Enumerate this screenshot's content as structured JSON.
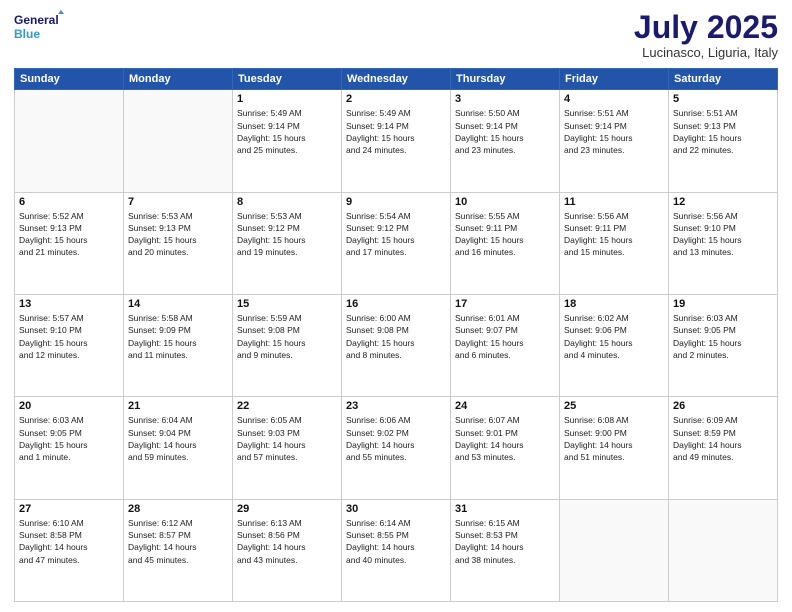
{
  "header": {
    "logo_line1": "General",
    "logo_line2": "Blue",
    "month_title": "July 2025",
    "subtitle": "Lucinasco, Liguria, Italy"
  },
  "weekdays": [
    "Sunday",
    "Monday",
    "Tuesday",
    "Wednesday",
    "Thursday",
    "Friday",
    "Saturday"
  ],
  "weeks": [
    [
      {
        "day": "",
        "info": ""
      },
      {
        "day": "",
        "info": ""
      },
      {
        "day": "1",
        "info": "Sunrise: 5:49 AM\nSunset: 9:14 PM\nDaylight: 15 hours\nand 25 minutes."
      },
      {
        "day": "2",
        "info": "Sunrise: 5:49 AM\nSunset: 9:14 PM\nDaylight: 15 hours\nand 24 minutes."
      },
      {
        "day": "3",
        "info": "Sunrise: 5:50 AM\nSunset: 9:14 PM\nDaylight: 15 hours\nand 23 minutes."
      },
      {
        "day": "4",
        "info": "Sunrise: 5:51 AM\nSunset: 9:14 PM\nDaylight: 15 hours\nand 23 minutes."
      },
      {
        "day": "5",
        "info": "Sunrise: 5:51 AM\nSunset: 9:13 PM\nDaylight: 15 hours\nand 22 minutes."
      }
    ],
    [
      {
        "day": "6",
        "info": "Sunrise: 5:52 AM\nSunset: 9:13 PM\nDaylight: 15 hours\nand 21 minutes."
      },
      {
        "day": "7",
        "info": "Sunrise: 5:53 AM\nSunset: 9:13 PM\nDaylight: 15 hours\nand 20 minutes."
      },
      {
        "day": "8",
        "info": "Sunrise: 5:53 AM\nSunset: 9:12 PM\nDaylight: 15 hours\nand 19 minutes."
      },
      {
        "day": "9",
        "info": "Sunrise: 5:54 AM\nSunset: 9:12 PM\nDaylight: 15 hours\nand 17 minutes."
      },
      {
        "day": "10",
        "info": "Sunrise: 5:55 AM\nSunset: 9:11 PM\nDaylight: 15 hours\nand 16 minutes."
      },
      {
        "day": "11",
        "info": "Sunrise: 5:56 AM\nSunset: 9:11 PM\nDaylight: 15 hours\nand 15 minutes."
      },
      {
        "day": "12",
        "info": "Sunrise: 5:56 AM\nSunset: 9:10 PM\nDaylight: 15 hours\nand 13 minutes."
      }
    ],
    [
      {
        "day": "13",
        "info": "Sunrise: 5:57 AM\nSunset: 9:10 PM\nDaylight: 15 hours\nand 12 minutes."
      },
      {
        "day": "14",
        "info": "Sunrise: 5:58 AM\nSunset: 9:09 PM\nDaylight: 15 hours\nand 11 minutes."
      },
      {
        "day": "15",
        "info": "Sunrise: 5:59 AM\nSunset: 9:08 PM\nDaylight: 15 hours\nand 9 minutes."
      },
      {
        "day": "16",
        "info": "Sunrise: 6:00 AM\nSunset: 9:08 PM\nDaylight: 15 hours\nand 8 minutes."
      },
      {
        "day": "17",
        "info": "Sunrise: 6:01 AM\nSunset: 9:07 PM\nDaylight: 15 hours\nand 6 minutes."
      },
      {
        "day": "18",
        "info": "Sunrise: 6:02 AM\nSunset: 9:06 PM\nDaylight: 15 hours\nand 4 minutes."
      },
      {
        "day": "19",
        "info": "Sunrise: 6:03 AM\nSunset: 9:05 PM\nDaylight: 15 hours\nand 2 minutes."
      }
    ],
    [
      {
        "day": "20",
        "info": "Sunrise: 6:03 AM\nSunset: 9:05 PM\nDaylight: 15 hours\nand 1 minute."
      },
      {
        "day": "21",
        "info": "Sunrise: 6:04 AM\nSunset: 9:04 PM\nDaylight: 14 hours\nand 59 minutes."
      },
      {
        "day": "22",
        "info": "Sunrise: 6:05 AM\nSunset: 9:03 PM\nDaylight: 14 hours\nand 57 minutes."
      },
      {
        "day": "23",
        "info": "Sunrise: 6:06 AM\nSunset: 9:02 PM\nDaylight: 14 hours\nand 55 minutes."
      },
      {
        "day": "24",
        "info": "Sunrise: 6:07 AM\nSunset: 9:01 PM\nDaylight: 14 hours\nand 53 minutes."
      },
      {
        "day": "25",
        "info": "Sunrise: 6:08 AM\nSunset: 9:00 PM\nDaylight: 14 hours\nand 51 minutes."
      },
      {
        "day": "26",
        "info": "Sunrise: 6:09 AM\nSunset: 8:59 PM\nDaylight: 14 hours\nand 49 minutes."
      }
    ],
    [
      {
        "day": "27",
        "info": "Sunrise: 6:10 AM\nSunset: 8:58 PM\nDaylight: 14 hours\nand 47 minutes."
      },
      {
        "day": "28",
        "info": "Sunrise: 6:12 AM\nSunset: 8:57 PM\nDaylight: 14 hours\nand 45 minutes."
      },
      {
        "day": "29",
        "info": "Sunrise: 6:13 AM\nSunset: 8:56 PM\nDaylight: 14 hours\nand 43 minutes."
      },
      {
        "day": "30",
        "info": "Sunrise: 6:14 AM\nSunset: 8:55 PM\nDaylight: 14 hours\nand 40 minutes."
      },
      {
        "day": "31",
        "info": "Sunrise: 6:15 AM\nSunset: 8:53 PM\nDaylight: 14 hours\nand 38 minutes."
      },
      {
        "day": "",
        "info": ""
      },
      {
        "day": "",
        "info": ""
      }
    ]
  ]
}
